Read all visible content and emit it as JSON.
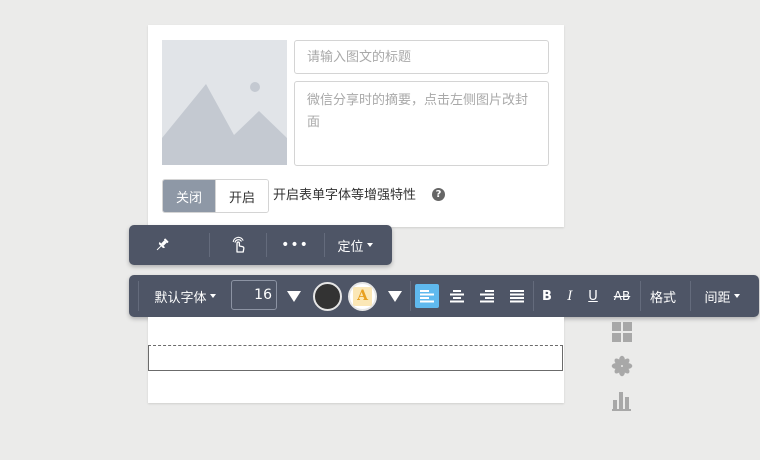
{
  "cover": {
    "title_placeholder": "请输入图文的标题",
    "summary_placeholder": "微信分享时的摘要，点击左侧图片改封面"
  },
  "toggle": {
    "off_label": "关闭",
    "on_label": "开启",
    "description": "开启表单字体等增强特性",
    "help_icon": "?",
    "state": "关闭"
  },
  "toolbar1": {
    "icons": [
      "pin-icon",
      "tap-icon",
      "more-icon"
    ],
    "more_label": "•••",
    "position_label": "定位"
  },
  "toolbar2": {
    "font_family": "默认字体",
    "font_size": "16",
    "font_color": "#333333",
    "bg_color_letter": "A",
    "align_active": "left",
    "bold": "B",
    "italic": "I",
    "underline": "U",
    "strike": "AB",
    "format_label": "格式",
    "spacing_label": "间距"
  },
  "side_icons": [
    "grid-icon",
    "asterisk-icon",
    "bar-chart-icon"
  ],
  "colors": {
    "toolbar_bg": "#4e5566",
    "accent": "#5fb9ee",
    "toggle_active": "#8e98a6"
  }
}
